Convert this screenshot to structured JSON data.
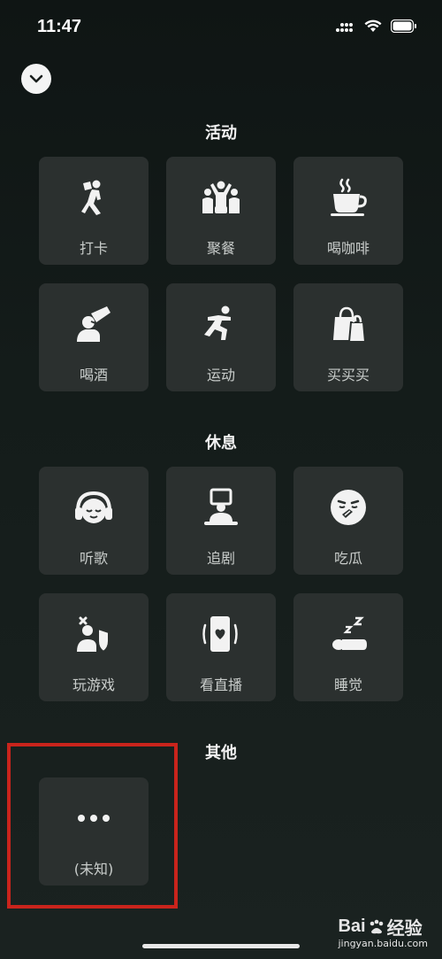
{
  "status_bar": {
    "time": "11:47"
  },
  "sections": {
    "activity": {
      "title": "活动",
      "items": [
        {
          "label": "打卡",
          "icon": "check-in-icon"
        },
        {
          "label": "聚餐",
          "icon": "party-icon"
        },
        {
          "label": "喝咖啡",
          "icon": "coffee-icon"
        },
        {
          "label": "喝酒",
          "icon": "drink-icon"
        },
        {
          "label": "运动",
          "icon": "exercise-icon"
        },
        {
          "label": "买买买",
          "icon": "shopping-icon"
        }
      ]
    },
    "rest": {
      "title": "休息",
      "items": [
        {
          "label": "听歌",
          "icon": "headphones-icon"
        },
        {
          "label": "追剧",
          "icon": "watching-icon"
        },
        {
          "label": "吃瓜",
          "icon": "gossip-icon"
        },
        {
          "label": "玩游戏",
          "icon": "game-icon"
        },
        {
          "label": "看直播",
          "icon": "livestream-icon"
        },
        {
          "label": "睡觉",
          "icon": "sleep-icon"
        }
      ]
    },
    "other": {
      "title": "其他",
      "items": [
        {
          "label": "(未知)",
          "icon": "more-icon"
        }
      ]
    }
  },
  "watermark": {
    "brand": "Bai",
    "brand_suffix": "经验",
    "site": "jingyan.baidu.com"
  },
  "colors": {
    "tile": "#2b302f",
    "highlight": "#c9241c"
  }
}
